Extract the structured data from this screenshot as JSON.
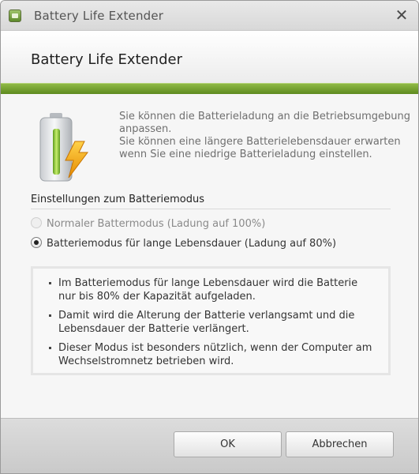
{
  "window": {
    "title": "Battery Life Extender",
    "app_icon": "battery-app-icon",
    "close_glyph": "✕"
  },
  "header": {
    "title": "Battery Life Extender"
  },
  "colors": {
    "accent_green": "#6f9d2e",
    "bolt_yellow": "#f2a20a"
  },
  "intro": {
    "icon": "battery-bolt-icon",
    "line1": "Sie können die Batterieladung an die Betriebsumgebung anpassen.",
    "line2": "Sie können eine längere Batterielebensdauer erwarten wenn Sie eine niedrige Batterieladung einstellen."
  },
  "mode_section": {
    "title": "Einstellungen zum Batteriemodus",
    "options": [
      {
        "label": "Normaler Battermodus (Ladung auf 100%)",
        "selected": false,
        "enabled": false
      },
      {
        "label": "Batteriemodus für lange Lebensdauer (Ladung auf 80%)",
        "selected": true,
        "enabled": true
      }
    ]
  },
  "info": {
    "items": [
      "Im Batteriemodus für lange Lebensdauer wird die Batterie nur bis 80% der Kapazität aufgeladen.",
      "Damit wird die Alterung der Batterie verlangsamt und die Lebensdauer der Batterie verlängert.",
      "Dieser Modus ist besonders nützlich, wenn der Computer am Wechselstromnetz betrieben wird."
    ]
  },
  "footer": {
    "ok_label": "OK",
    "cancel_label": "Abbrechen"
  }
}
